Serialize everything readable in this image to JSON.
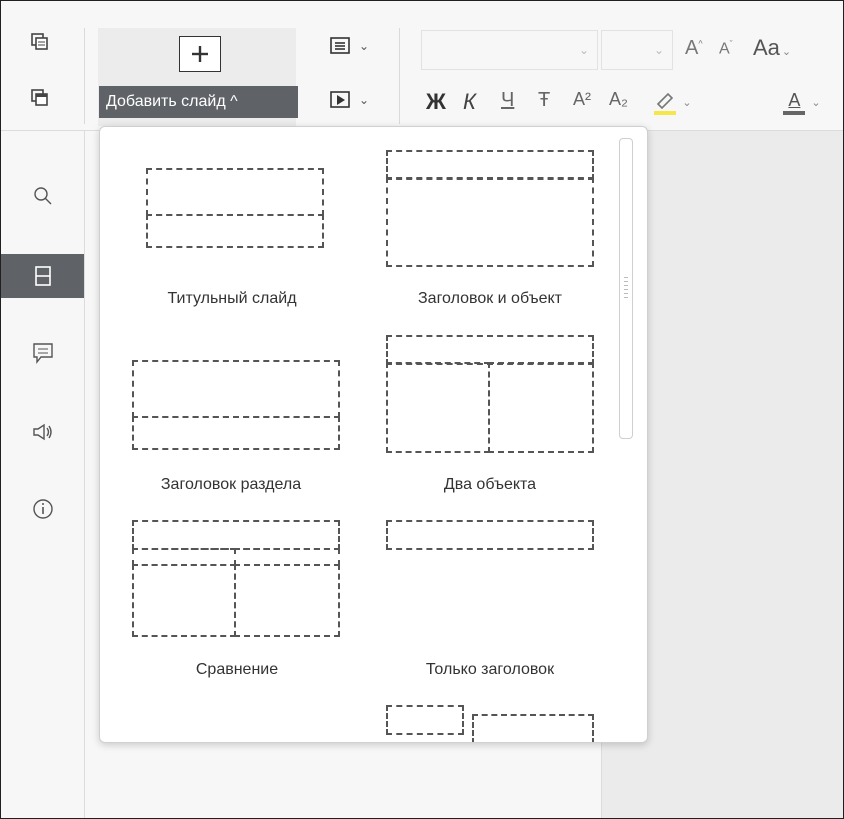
{
  "toolbar": {
    "add_slide_label": "Добавить слайд ^",
    "font_name_value": "",
    "font_size_value": "",
    "bold": "Ж",
    "italic": "К",
    "underline": "Ч",
    "strike": "Ŧ",
    "superscript": "A²",
    "subscript": "A₂",
    "increase_font": "A",
    "decrease_font": "A",
    "change_case": "Aa",
    "font_color": "A",
    "highlight_color": "#f5e74a",
    "font_color_value": "#666666"
  },
  "rail": {
    "items": [
      "search-icon",
      "slides-icon",
      "comment-icon",
      "announce-icon",
      "info-icon"
    ],
    "active": "slides-icon"
  },
  "layouts": [
    {
      "name": "Титульный слайд"
    },
    {
      "name": "Заголовок и объект"
    },
    {
      "name": "Заголовок раздела"
    },
    {
      "name": "Два объекта"
    },
    {
      "name": "Сравнение"
    },
    {
      "name": "Только заголовок"
    }
  ]
}
